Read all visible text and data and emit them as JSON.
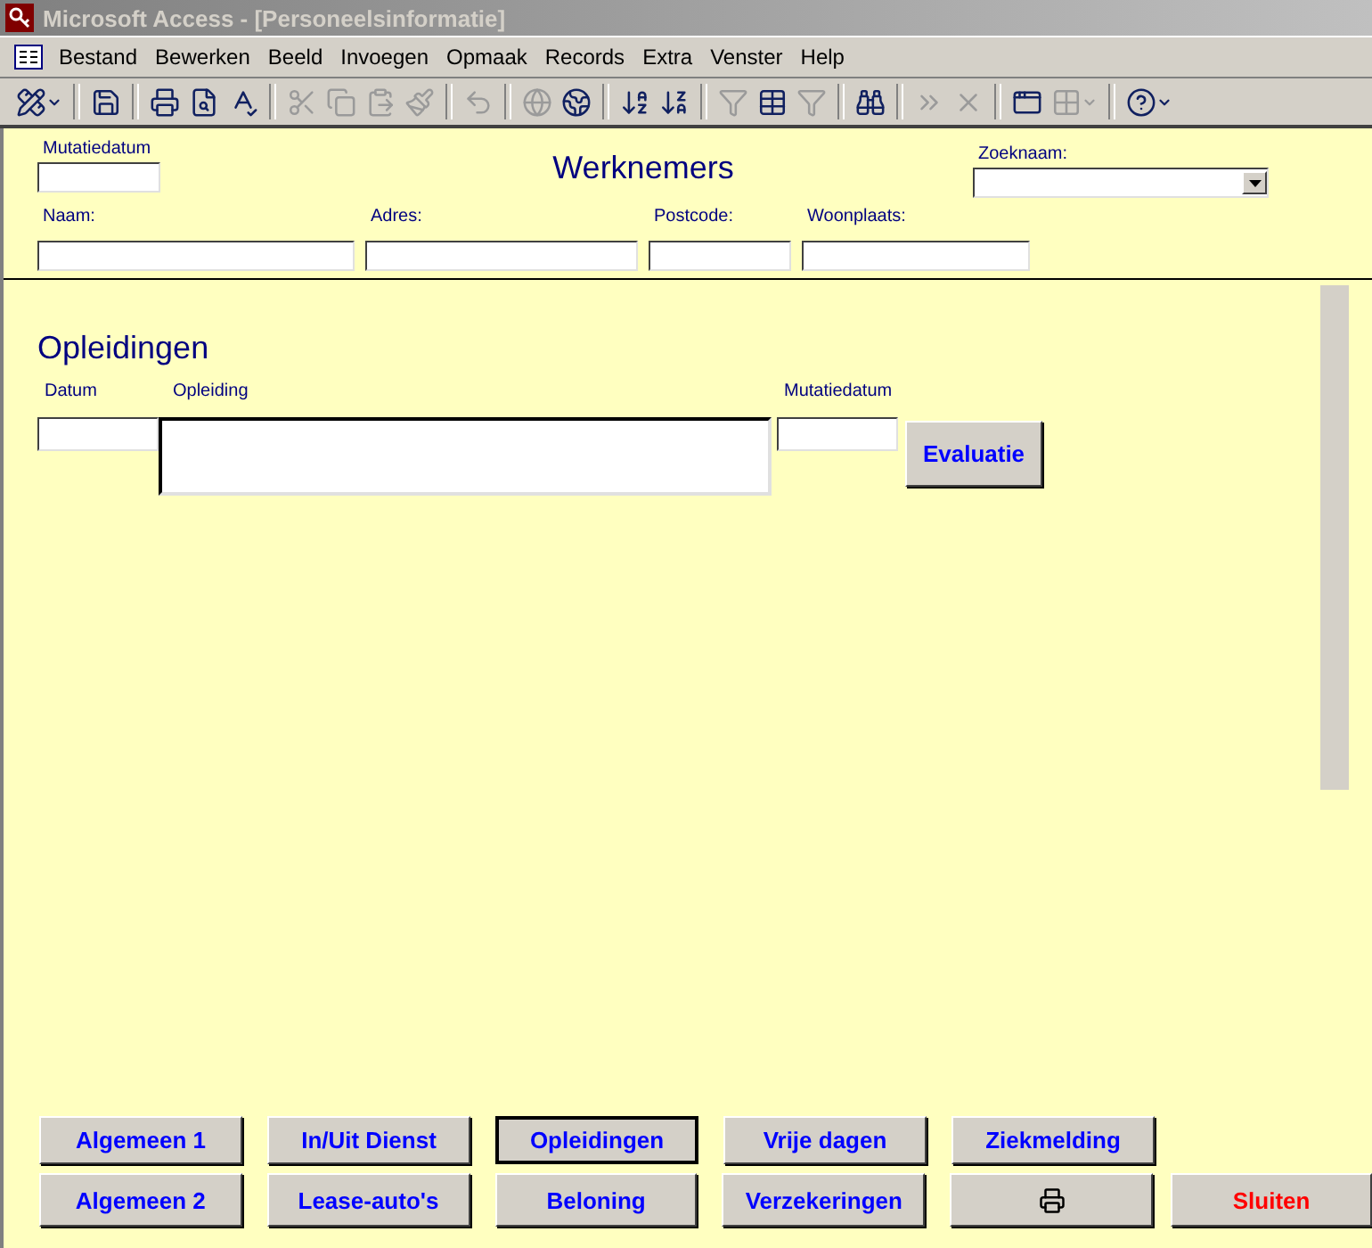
{
  "window": {
    "title": "Microsoft Access - [Personeelsinformatie]"
  },
  "menu": [
    "Bestand",
    "Bewerken",
    "Beeld",
    "Invoegen",
    "Opmaak",
    "Records",
    "Extra",
    "Venster",
    "Help"
  ],
  "toolbar": [
    {
      "kind": "design",
      "disabled": false
    },
    {
      "kind": "sep"
    },
    {
      "kind": "save",
      "disabled": false
    },
    {
      "kind": "sep"
    },
    {
      "kind": "print",
      "disabled": false
    },
    {
      "kind": "preview",
      "disabled": false
    },
    {
      "kind": "spelling",
      "disabled": false
    },
    {
      "kind": "sep"
    },
    {
      "kind": "cut",
      "disabled": true
    },
    {
      "kind": "copy",
      "disabled": true
    },
    {
      "kind": "paste",
      "disabled": true
    },
    {
      "kind": "painter",
      "disabled": true
    },
    {
      "kind": "sep"
    },
    {
      "kind": "undo",
      "disabled": true
    },
    {
      "kind": "sep"
    },
    {
      "kind": "web",
      "disabled": true
    },
    {
      "kind": "hyperlink",
      "disabled": false
    },
    {
      "kind": "sep"
    },
    {
      "kind": "sortasc",
      "disabled": false
    },
    {
      "kind": "sortdesc",
      "disabled": false
    },
    {
      "kind": "sep"
    },
    {
      "kind": "filtersel",
      "disabled": true
    },
    {
      "kind": "filterform",
      "disabled": false
    },
    {
      "kind": "filter",
      "disabled": true
    },
    {
      "kind": "sep"
    },
    {
      "kind": "find",
      "disabled": false
    },
    {
      "kind": "sep"
    },
    {
      "kind": "newrecord",
      "disabled": true
    },
    {
      "kind": "deleterecord",
      "disabled": true
    },
    {
      "kind": "sep"
    },
    {
      "kind": "dbwindow",
      "disabled": false
    },
    {
      "kind": "newobject",
      "disabled": true
    },
    {
      "kind": "sep"
    },
    {
      "kind": "help",
      "disabled": false
    }
  ],
  "header": {
    "mutation_date_label": "Mutatiedatum",
    "title": "Werknemers",
    "search_label": "Zoeknaam:",
    "fields": [
      {
        "label": "Naam:"
      },
      {
        "label": "Adres:"
      },
      {
        "label": "Postcode:"
      },
      {
        "label": "Woonplaats:"
      }
    ]
  },
  "subform": {
    "title": "Opleidingen",
    "columns": [
      "Datum",
      "Opleiding",
      "Mutatiedatum"
    ],
    "button": "Evaluatie"
  },
  "button_rows": [
    [
      {
        "kind": "text",
        "label": "Algemeen 1",
        "selected": false,
        "color": "#0000ff"
      },
      {
        "kind": "text",
        "label": "In/Uit Dienst",
        "selected": false,
        "color": "#0000ff"
      },
      {
        "kind": "text",
        "label": "Opleidingen",
        "selected": true,
        "color": "#0000ff"
      },
      {
        "kind": "text",
        "label": "Vrije dagen",
        "selected": false,
        "color": "#0000ff"
      },
      {
        "kind": "text",
        "label": "Ziekmelding",
        "selected": false,
        "color": "#0000ff"
      }
    ],
    [
      {
        "kind": "text",
        "label": "Algemeen 2",
        "selected": false,
        "color": "#0000ff"
      },
      {
        "kind": "text",
        "label": "Lease-auto's",
        "selected": false,
        "color": "#0000ff"
      },
      {
        "kind": "text",
        "label": "Beloning",
        "selected": false,
        "color": "#0000ff"
      },
      {
        "kind": "text",
        "label": "Verzekeringen",
        "selected": false,
        "color": "#0000ff"
      },
      {
        "kind": "print",
        "selected": false,
        "color": "#000000"
      },
      {
        "kind": "text",
        "label": "Sluiten",
        "selected": false,
        "color": "#ff0000"
      }
    ]
  ]
}
